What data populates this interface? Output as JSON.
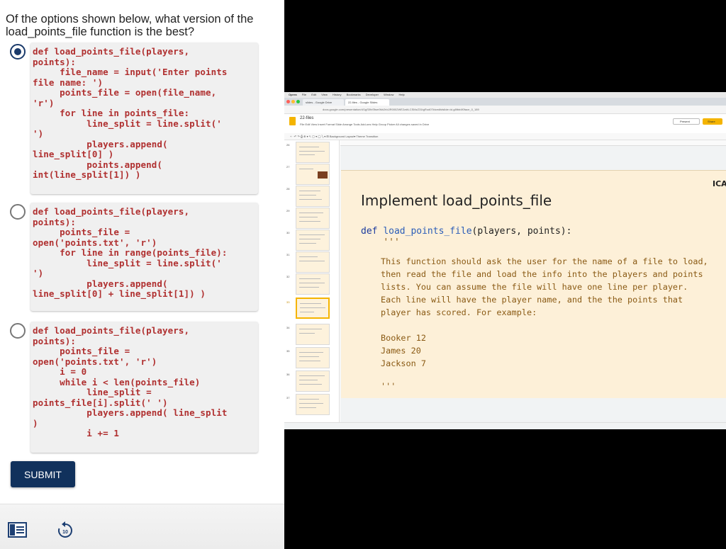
{
  "quiz": {
    "question": "Of the options shown below, what version of the load_points_file function is the best?",
    "options": [
      {
        "selected": true,
        "code": "def load_points_file(players,\npoints):\n     file_name = input('Enter points\nfile name: ')\n     points_file = open(file_name,\n'r')\n     for line in points_file:\n          line_split = line.split('\n')\n          players.append(\nline_split[0] )\n          points.append(\nint(line_split[1]) )"
      },
      {
        "selected": false,
        "code": "def load_points_file(players,\npoints):\n     points_file =\nopen('points.txt', 'r')\n     for line in range(points_file):\n          line_split = line.split('\n')\n          players.append(\nline_split[0] + line_split[1]) )"
      },
      {
        "selected": false,
        "code": "def load_points_file(players,\npoints):\n     points_file =\nopen('points.txt', 'r')\n     i = 0\n     while i < len(points_file)\n          line_split =\npoints_file[i].split(' ')\n          players.append( line_split\n)\n          i += 1"
      }
    ],
    "submit_label": "SUBMIT",
    "replay_seconds": "10",
    "icons": [
      "notes-icon",
      "replay-10-icon"
    ],
    "accent_color": "#11315c",
    "code_color": "#b03030"
  },
  "video": {
    "menubar": [
      "Opera",
      "File",
      "Edit",
      "View",
      "History",
      "Bookmarks",
      "Developer",
      "Window",
      "Help"
    ],
    "tabs": [
      "slides - Google Drive",
      "22-files - Google Slides"
    ],
    "url": "docs.google.com/presentation/d/1gS0fxSfsm9kb2rIdJR0002WE2zdtLCSMzZ31tgRod07ktcedit#slide=id.g8fbb4f0face_0_189",
    "doc_title": "22-files",
    "doc_menu": "File  Edit  View  Insert  Format  Slide  Arrange  Tools  Add-ons  Help  Group Picker   All changes saved in Drive",
    "toolbar_text": "+  ·  ↶  ↷  ⎙  ⊕  ▾   ↖  ▢  ▾  ◯  ╲  ▾    ⊞  Background   Layout▾   Theme   Transition",
    "present_label": "Present",
    "share_label": "Share",
    "slide_numbers": [
      "26",
      "27",
      "28",
      "29",
      "30",
      "31",
      "32",
      "33",
      "34",
      "35",
      "36",
      "37"
    ],
    "selected_slide": "33",
    "slide": {
      "title": "Implement load_points_file",
      "corner_label": "ICA",
      "code_keyword": "def",
      "code_function": "load_points_file",
      "code_args": "(players, points):",
      "docstring_open": "'''",
      "description": "This function should ask the user for the name of a file to load,\nthen read the file and load the info into the players and points\nlists. You can assume the file will have one line per player.\nEach line will have the player name, and the the points that\nplayer has scored. For example:",
      "example": "Booker 12\nJames 20\nJackson 7",
      "docstring_close": "'''"
    }
  }
}
